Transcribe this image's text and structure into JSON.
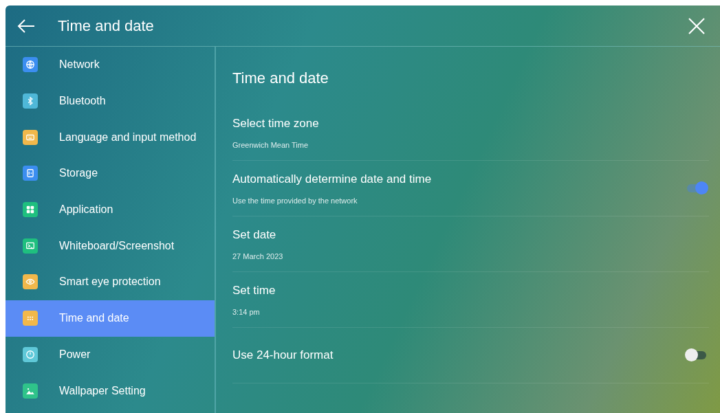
{
  "header": {
    "title": "Time and date"
  },
  "sidebar": {
    "items": [
      {
        "label": "Network",
        "kind": "globe",
        "color": "#3b8ef0",
        "selected": false
      },
      {
        "label": "Bluetooth",
        "kind": "bluetooth",
        "color": "#4fb8d8",
        "selected": false
      },
      {
        "label": "Language and input method",
        "kind": "keyboard",
        "color": "#f2b84b",
        "selected": false
      },
      {
        "label": "Storage",
        "kind": "storage",
        "color": "#3b8ef0",
        "selected": false
      },
      {
        "label": "Application",
        "kind": "apps",
        "color": "#1fbf7f",
        "selected": false
      },
      {
        "label": "Whiteboard/Screenshot",
        "kind": "whiteboard",
        "color": "#1fbf7f",
        "selected": false
      },
      {
        "label": "Smart eye protection",
        "kind": "eye",
        "color": "#f2b84b",
        "selected": false
      },
      {
        "label": "Time and date",
        "kind": "calendar",
        "color": "#f2b84b",
        "selected": true
      },
      {
        "label": "Power",
        "kind": "power",
        "color": "#5fc8d8",
        "selected": false
      },
      {
        "label": "Wallpaper Setting",
        "kind": "picture",
        "color": "#2fc38a",
        "selected": false
      }
    ]
  },
  "content": {
    "title": "Time and date",
    "settings": [
      {
        "kind": "link",
        "title": "Select time zone",
        "value": "Greenwich Mean Time"
      },
      {
        "kind": "toggle",
        "title": "Automatically determine date and time",
        "value": "Use the time provided by the network",
        "on": true
      },
      {
        "kind": "link",
        "title": "Set date",
        "value": "27 March 2023"
      },
      {
        "kind": "link",
        "title": "Set time",
        "value": "3:14 pm"
      },
      {
        "kind": "toggle",
        "title": "Use 24-hour format",
        "on": false
      }
    ]
  }
}
